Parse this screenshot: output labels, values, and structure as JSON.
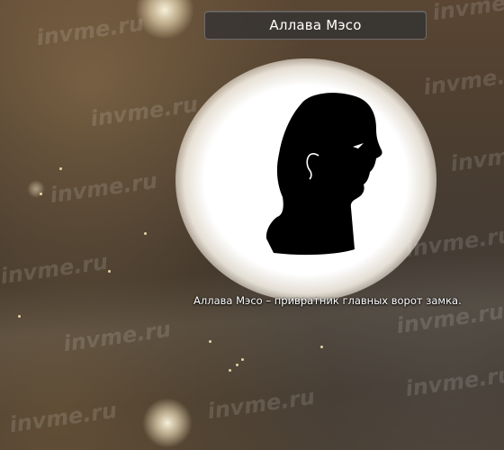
{
  "character": {
    "name": "Аллава Мэсо",
    "description": "Аллава Мэсо – привратник главных ворот замка."
  },
  "portrait": {
    "icon": "silhouette-head-icon",
    "glow_color": "#ffffff",
    "silhouette_color": "#000000"
  },
  "watermark": {
    "text": "invme.ru"
  },
  "colors": {
    "name_bar_bg": "#323232",
    "text": "#ffffff",
    "background": "#4b3d2f"
  }
}
